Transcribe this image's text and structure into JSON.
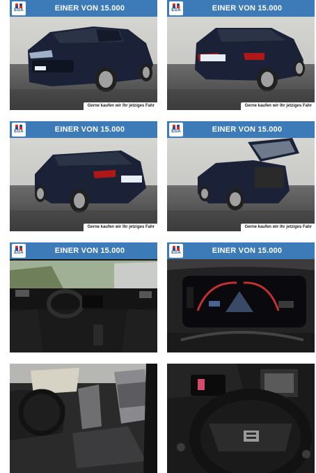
{
  "banner": {
    "title": "EINER VON 15.000",
    "logo_text": "EGA"
  },
  "footer_text": "Gerne kaufen wir Ihr jetziges Fahr",
  "tiles": [
    {
      "subject": "front-three-quarter-exterior",
      "has_banner": true,
      "has_footer": true
    },
    {
      "subject": "rear-three-quarter-exterior",
      "has_banner": true,
      "has_footer": true
    },
    {
      "subject": "rear-side-exterior",
      "has_banner": true,
      "has_footer": true
    },
    {
      "subject": "open-tailgate-exterior",
      "has_banner": true,
      "has_footer": true
    },
    {
      "subject": "dashboard-interior",
      "has_banner": true,
      "has_footer": false
    },
    {
      "subject": "digital-instrument-cluster",
      "has_banner": true,
      "has_footer": false
    },
    {
      "subject": "front-seats-interior",
      "has_banner": false,
      "has_footer": false
    },
    {
      "subject": "steering-wheel-closeup",
      "has_banner": false,
      "has_footer": false
    }
  ],
  "colors": {
    "banner_blue": "#3d7ab8",
    "car_navy": "#1b2238",
    "logo_blue": "#1f4e8c"
  }
}
